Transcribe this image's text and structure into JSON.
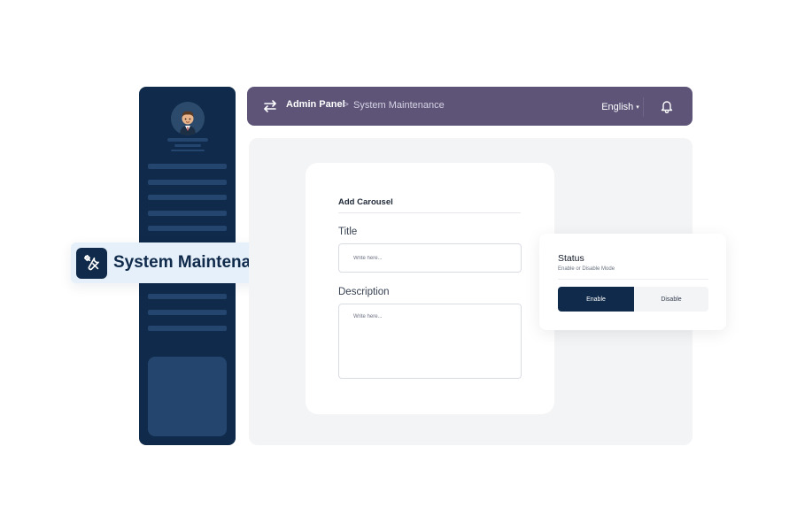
{
  "sidebar": {
    "avatar_icon": "user-avatar-icon",
    "nav_items_count_visible": 9
  },
  "badge": {
    "icon": "tools-icon",
    "label": "System Maintenance"
  },
  "topbar": {
    "menu_icon": "swap-arrows-icon",
    "breadcrumb": {
      "root": "Admin Panel",
      "separator": ">",
      "current": "System Maintenance"
    },
    "language": {
      "selected": "English",
      "arrow": "▾"
    },
    "notification_icon": "bell-icon"
  },
  "form": {
    "heading": "Add Carousel",
    "title_label": "Title",
    "title_placeholder": "Write here...",
    "description_label": "Description",
    "description_placeholder": "Write here..."
  },
  "status": {
    "title": "Status",
    "subtitle": "Enable or Disable Mode",
    "enable_label": "Enable",
    "disable_label": "Disable",
    "selected": "Enable"
  },
  "colors": {
    "sidebar": "#0f2a4a",
    "topbar": "#5d5478",
    "badge_bg": "#e6f0fa",
    "accent": "#0f2a4a"
  }
}
